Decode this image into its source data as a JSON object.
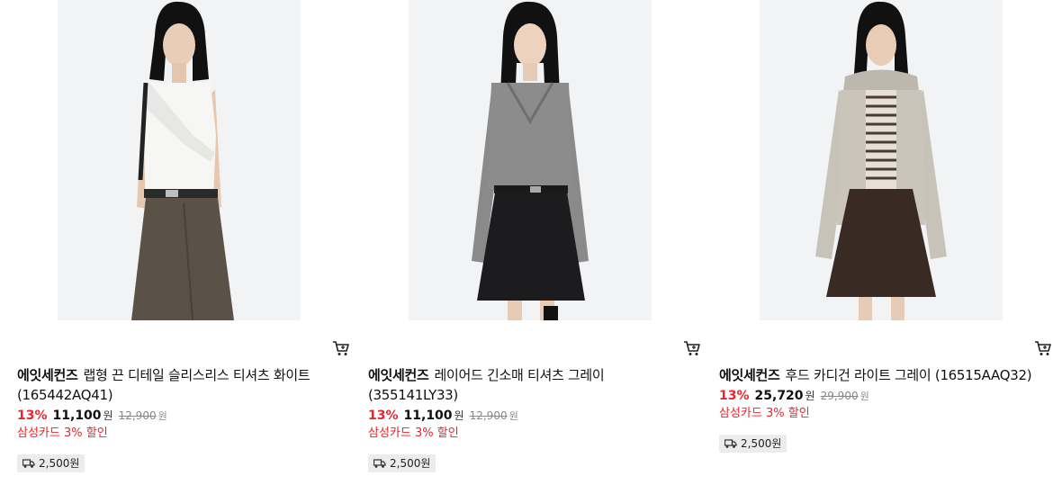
{
  "products": [
    {
      "brand": "에잇세컨즈",
      "title": "랩형 끈 디테일 슬리스리스 티셔츠 화이트",
      "title_line2": "(165442AQ41)",
      "discount": "13%",
      "price": "11,100",
      "price_unit": "원",
      "original_price": "12,900",
      "original_unit": "원",
      "card_offer": "삼성카드 3% 할인",
      "shipping": "2,500원",
      "colors": {
        "top": "#f5f5f3",
        "bottom": "#5a5147"
      }
    },
    {
      "brand": "에잇세컨즈",
      "title": "레이어드 긴소매 티셔츠 그레이",
      "title_line2": "(355141LY33)",
      "discount": "13%",
      "price": "11,100",
      "price_unit": "원",
      "original_price": "12,900",
      "original_unit": "원",
      "card_offer": "삼성카드 3% 할인",
      "shipping": "2,500원",
      "colors": {
        "top": "#8a8a8a",
        "bottom": "#1c1c1e"
      }
    },
    {
      "brand": "에잇세컨즈",
      "title": "후드 카디건 라이트 그레이 (16515AAQ32)",
      "title_line2": "",
      "discount": "13%",
      "price": "25,720",
      "price_unit": "원",
      "original_price": "29,900",
      "original_unit": "원",
      "card_offer": "삼성카드 3% 할인",
      "shipping": "2,500원",
      "colors": {
        "top": "#c8c3b9",
        "bottom": "#3a2a24"
      }
    }
  ],
  "icons": {
    "cart": "cart-icon",
    "shipping": "truck-icon"
  },
  "accent_color": "#e8262b"
}
